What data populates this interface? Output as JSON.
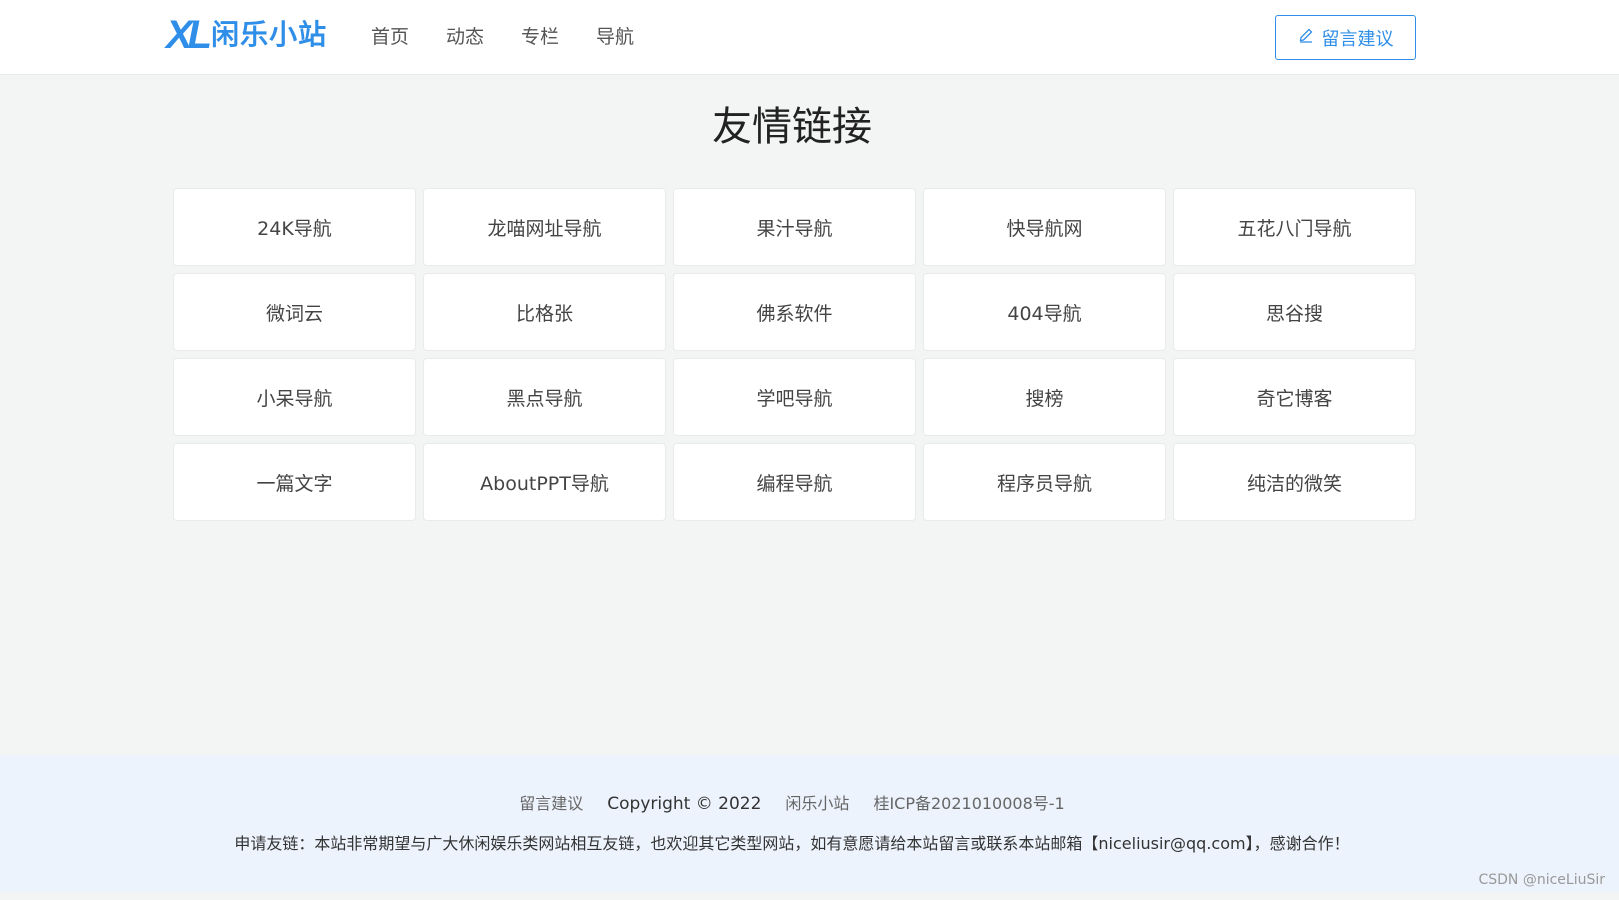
{
  "header": {
    "logo_mark": "XL",
    "logo_text": "闲乐小站",
    "nav": [
      {
        "label": "首页"
      },
      {
        "label": "动态"
      },
      {
        "label": "专栏"
      },
      {
        "label": "导航"
      }
    ],
    "suggest_button": "留言建议",
    "accent_color": "#2f8fe8"
  },
  "main": {
    "title": "友情链接",
    "links": [
      "24K导航",
      "龙喵网址导航",
      "果汁导航",
      "快导航网",
      "五花八门导航",
      "微词云",
      "比格张",
      "佛系软件",
      "404导航",
      "思谷搜",
      "小呆导航",
      "黑点导航",
      "学吧导航",
      "搜榜",
      "奇它博客",
      "一篇文字",
      "AboutPPT导航",
      "编程导航",
      "程序员导航",
      "纯洁的微笑"
    ]
  },
  "footer": {
    "suggest_link": "留言建议",
    "copyright": "Copyright © 2022",
    "site_name": "闲乐小站",
    "icp": "桂ICP备2021010008号-1",
    "apply_text": "申请友链：本站非常期望与广大休闲娱乐类网站相互友链，也欢迎其它类型网站，如有意愿请给本站留言或联系本站邮箱【niceliusir@qq.com】，感谢合作！"
  },
  "watermark": "CSDN @niceLiuSir"
}
